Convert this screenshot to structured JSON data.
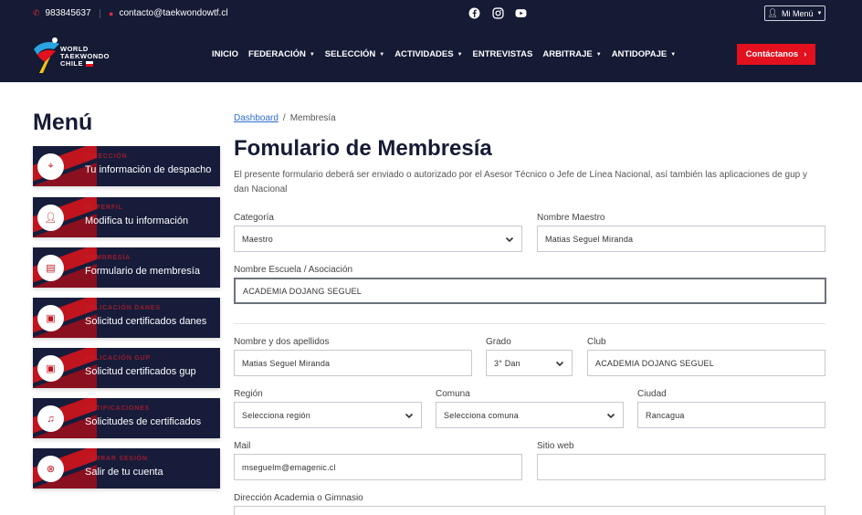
{
  "topbar": {
    "phone": "983845637",
    "email": "contacto@taekwondowtf.cl",
    "social": [
      "facebook-icon",
      "instagram-icon",
      "youtube-icon"
    ],
    "menu_label": "Mi Menú"
  },
  "header": {
    "logo_lines": [
      "WORLD",
      "TAEKWONDO",
      "CHILE"
    ],
    "nav": [
      {
        "label": "INICIO",
        "dropdown": false
      },
      {
        "label": "FEDERACIÓN",
        "dropdown": true
      },
      {
        "label": "SELECCIÓN",
        "dropdown": true
      },
      {
        "label": "ACTIVIDADES",
        "dropdown": true
      },
      {
        "label": "ENTREVISTAS",
        "dropdown": false
      },
      {
        "label": "ARBITRAJE",
        "dropdown": true
      },
      {
        "label": "ANTIDOPAJE",
        "dropdown": true
      }
    ],
    "contact_label": "Contáctanos"
  },
  "sidebar": {
    "title": "Menú",
    "items": [
      {
        "kicker": "DIRECCIÓN",
        "label": "Tu información de despacho",
        "icon": "location-pin-icon"
      },
      {
        "kicker": "MI PERFIL",
        "label": "Modifica tu información",
        "icon": "user-icon"
      },
      {
        "kicker": "MEMBRESÍA",
        "label": "Formulario de membresía",
        "icon": "document-icon"
      },
      {
        "kicker": "APLICACIÓN DANES",
        "label": "Solicitud certificados danes",
        "icon": "certificate-icon"
      },
      {
        "kicker": "APLICACIÓN GUP",
        "label": "Solicitud certificados gup",
        "icon": "certificate-icon"
      },
      {
        "kicker": "NOTIFICACIONES",
        "label": "Solicitudes de certificados",
        "icon": "bell-icon"
      },
      {
        "kicker": "CERRAR SESIÓN",
        "label": "Salir de tu cuenta",
        "icon": "close-circle-icon"
      }
    ]
  },
  "breadcrumb": {
    "home": "Dashboard",
    "separator": "/",
    "current": "Membresía"
  },
  "form": {
    "title": "Fomulario de Membresía",
    "description": "El presente formulario deberá ser enviado o autorizado por el Asesor Técnico o Jefe de Línea Nacional, así también las aplicaciones de gup y dan Nacional",
    "categoria": {
      "label": "Categoría",
      "value": "Maestro"
    },
    "nombre_maestro": {
      "label": "Nombre Maestro",
      "value": "Matias Seguel Miranda"
    },
    "escuela": {
      "label": "Nombre Escuela / Asociación",
      "value": "ACADEMIA DOJANG SEGUEL"
    },
    "nombre": {
      "label": "Nombre y dos apellidos",
      "value": "Matias Seguel Miranda"
    },
    "grado": {
      "label": "Grado",
      "value": "3° Dan"
    },
    "club": {
      "label": "Club",
      "value": "ACADEMIA DOJANG SEGUEL"
    },
    "region": {
      "label": "Región",
      "value": "Selecciona región"
    },
    "comuna": {
      "label": "Comuna",
      "value": "Selecciona comuna"
    },
    "ciudad": {
      "label": "Ciudad",
      "value": "Rancagua"
    },
    "mail": {
      "label": "Mail",
      "value": "mseguelm@emagenic.cl"
    },
    "sitio_web": {
      "label": "Sitio web",
      "value": ""
    },
    "direccion": {
      "label": "Dirección Academia o Gimnasio",
      "value": ""
    }
  },
  "colors": {
    "navy": "#151b34",
    "red": "#e3101e",
    "link": "#2e6cd1"
  }
}
